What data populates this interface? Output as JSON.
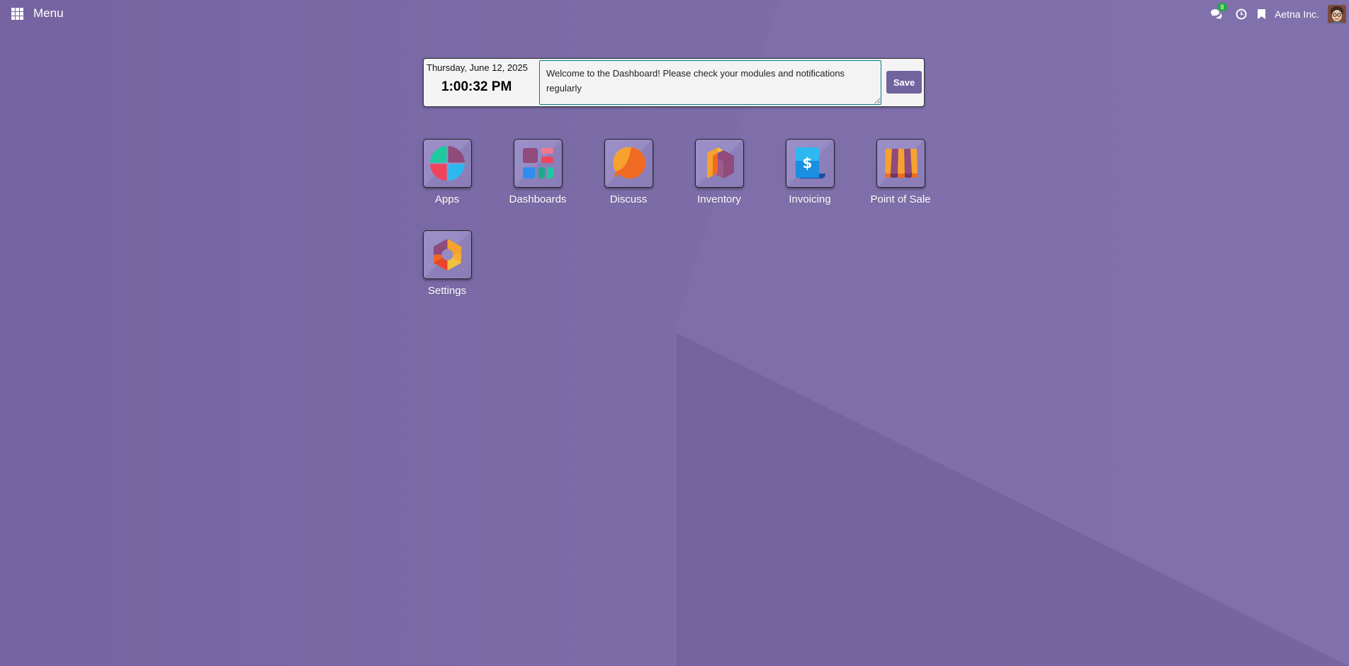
{
  "topbar": {
    "menu_label": "Menu",
    "chat_badge": "8",
    "company": "Aetna Inc."
  },
  "widget": {
    "date": "Thursday, June 12, 2025",
    "time": "1:00:32 PM",
    "notes": "Welcome to the Dashboard! Please check your modules and notifications regularly",
    "save_label": "Save"
  },
  "apps": [
    {
      "label": "Apps",
      "icon": "apps-icon"
    },
    {
      "label": "Dashboards",
      "icon": "dashboards-icon"
    },
    {
      "label": "Discuss",
      "icon": "discuss-icon"
    },
    {
      "label": "Inventory",
      "icon": "inventory-icon"
    },
    {
      "label": "Invoicing",
      "icon": "invoicing-icon"
    },
    {
      "label": "Point of Sale",
      "icon": "point-of-sale-icon"
    },
    {
      "label": "Settings",
      "icon": "settings-icon"
    }
  ],
  "colors": {
    "background": "#7a6aa6",
    "accent": "#71639e",
    "badge": "#28a745"
  }
}
